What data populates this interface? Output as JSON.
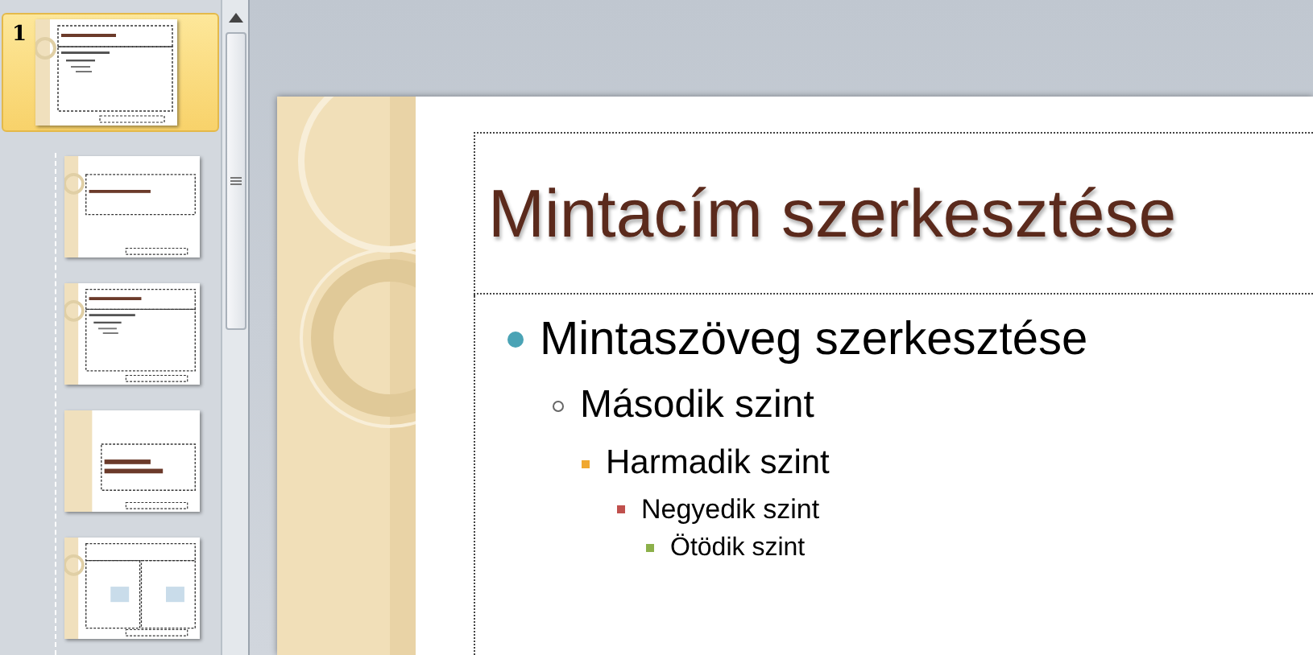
{
  "slide_panel": {
    "thumbnails": [
      {
        "number": "1",
        "selected": true,
        "kind": "content"
      },
      {
        "selected": false,
        "kind": "title"
      },
      {
        "selected": false,
        "kind": "content"
      },
      {
        "selected": false,
        "kind": "section"
      },
      {
        "selected": false,
        "kind": "comparison"
      }
    ]
  },
  "slide": {
    "title": "Mintacím szerkesztése",
    "body": [
      {
        "text": "Mintaszöveg szerkesztése",
        "color": "#4aa3b5",
        "children": [
          {
            "text": "Második szint",
            "color": "#666666",
            "children": [
              {
                "text": "Harmadik szint",
                "color": "#f0a830",
                "children": [
                  {
                    "text": "Negyedik szint",
                    "color": "#c0504d",
                    "children": [
                      {
                        "text": "Ötödik szint",
                        "color": "#8cb04a"
                      }
                    ]
                  }
                ]
              }
            ]
          }
        ]
      }
    ]
  }
}
